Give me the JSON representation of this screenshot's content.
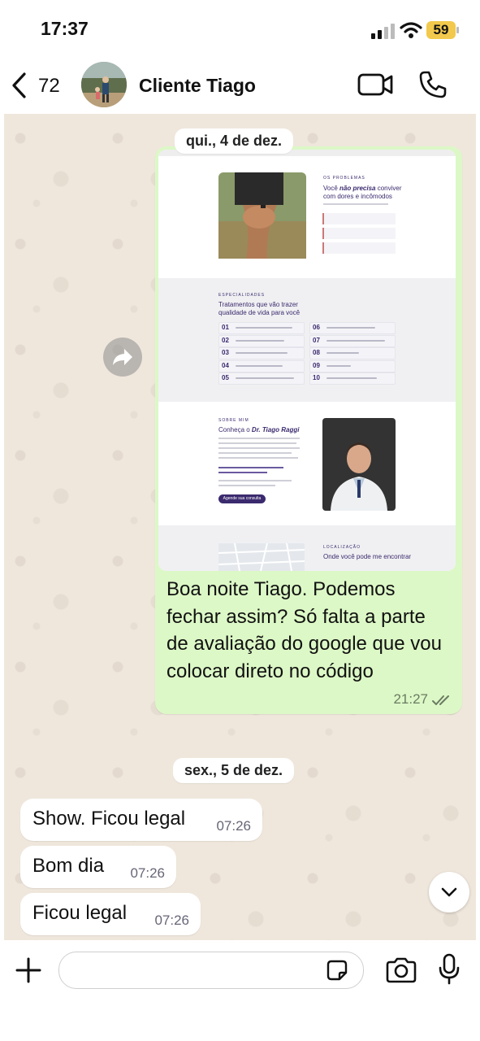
{
  "status_bar": {
    "time": "17:37",
    "battery": "59"
  },
  "header": {
    "unread_count": "72",
    "contact_name": "Cliente Tiago"
  },
  "dates": {
    "first": "qui., 4 de dez.",
    "second": "sex., 5 de dez."
  },
  "outgoing_message": {
    "text": "Boa noite Tiago. Podemos fechar assim? Só falta a parte de avaliação do google que vou colocar direto no código",
    "time": "21:27",
    "read": true,
    "preview": {
      "section1_eyebrow": "OS PROBLEMAS",
      "section1_heading_a": "Você ",
      "section1_heading_b": "não precisa",
      "section1_heading_c": " conviver",
      "section1_heading_d": "com dores e incômodos",
      "section2_eyebrow": "ESPECIALIDADES",
      "section2_heading_1": "Tratamentos que vão trazer",
      "section2_heading_2": "qualidade de vida para você",
      "treatments_left": [
        "01",
        "02",
        "03",
        "04",
        "05"
      ],
      "treatments_right": [
        "06",
        "07",
        "08",
        "09",
        "10"
      ],
      "section3_eyebrow": "SOBRE MIM",
      "section3_heading_a": "Conheça o ",
      "section3_heading_b": "Dr. Tiago Raggi",
      "section3_cta": "Agende sua consulta",
      "section4_eyebrow": "LOCALIZAÇÃO",
      "section4_heading": "Onde você pode me encontrar"
    }
  },
  "incoming_messages": [
    {
      "text": "Show. Ficou legal",
      "time": "07:26"
    },
    {
      "text": "Bom dia",
      "time": "07:26"
    },
    {
      "text": "Ficou legal",
      "time": "07:26"
    }
  ],
  "composer": {
    "placeholder": ""
  },
  "colors": {
    "outgoing_bubble": "#dcf8c6",
    "chat_background": "#efe7dc",
    "preview_accent": "#3b2a6e"
  }
}
